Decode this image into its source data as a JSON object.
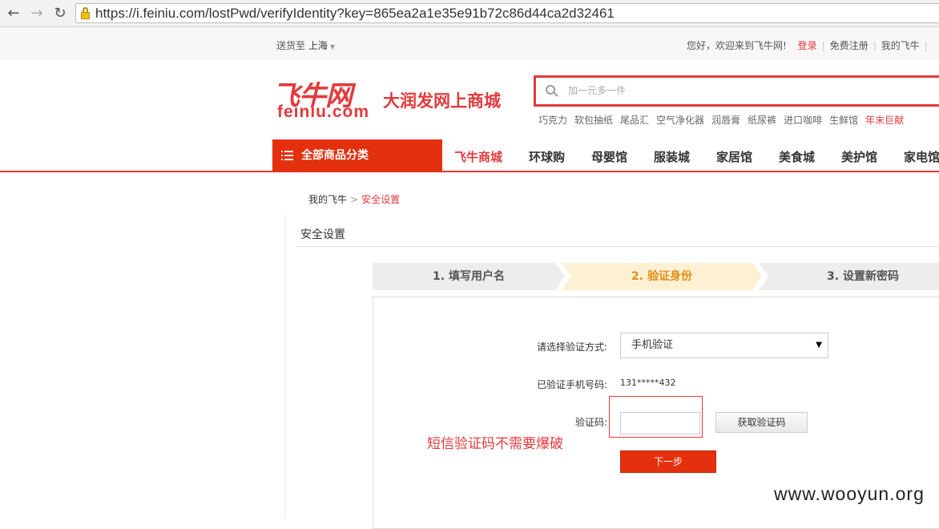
{
  "browser": {
    "url": "https://i.feiniu.com/lostPwd/verifyIdentity?key=865ea2a1e35e91b72c86d44ca2d32461",
    "back_icon": "←",
    "forward_icon": "→",
    "reload_icon": "↻"
  },
  "topbar": {
    "ship_label": "送货至",
    "ship_city": "上海",
    "welcome": "您好，欢迎来到飞牛网!",
    "login": "登录",
    "register": "免费注册",
    "my_account": "我的飞牛"
  },
  "logo": {
    "cn": "飞牛网",
    "en": "feiniu.com",
    "slogan": "大润发网上商城"
  },
  "search": {
    "placeholder": "加一元多一件"
  },
  "hotwords": [
    "巧克力",
    "软包抽纸",
    "尾品汇",
    "空气净化器",
    "润唇膏",
    "纸尿裤",
    "进口咖啡",
    "生鲜馆"
  ],
  "hotword_highlight": "年末巨献",
  "nav": {
    "category_button": "全部商品分类",
    "items": [
      "飞牛商城",
      "环球购",
      "母婴馆",
      "服装城",
      "家居馆",
      "美食城",
      "美护馆",
      "家电馆"
    ]
  },
  "breadcrumb": {
    "home": "我的飞牛",
    "current": "安全设置"
  },
  "section_title": "安全设置",
  "steps": [
    "1. 填写用户名",
    "2. 验证身份",
    "3. 设置新密码"
  ],
  "form": {
    "method_label": "请选择验证方式:",
    "method_value": "手机验证",
    "phone_label": "已验证手机号码:",
    "phone_value": "131*****432",
    "code_label": "验证码:",
    "code_value": "",
    "get_code_button": "获取验证码",
    "next_button": "下一步"
  },
  "annotation_note": "短信验证码不需要爆破",
  "watermark": "www.wooyun.org",
  "colors": {
    "brand_red": "#e4393c",
    "nav_red": "#e4300c",
    "step_active_bg": "#fdf0d3",
    "step_active_text": "#e38d13"
  }
}
